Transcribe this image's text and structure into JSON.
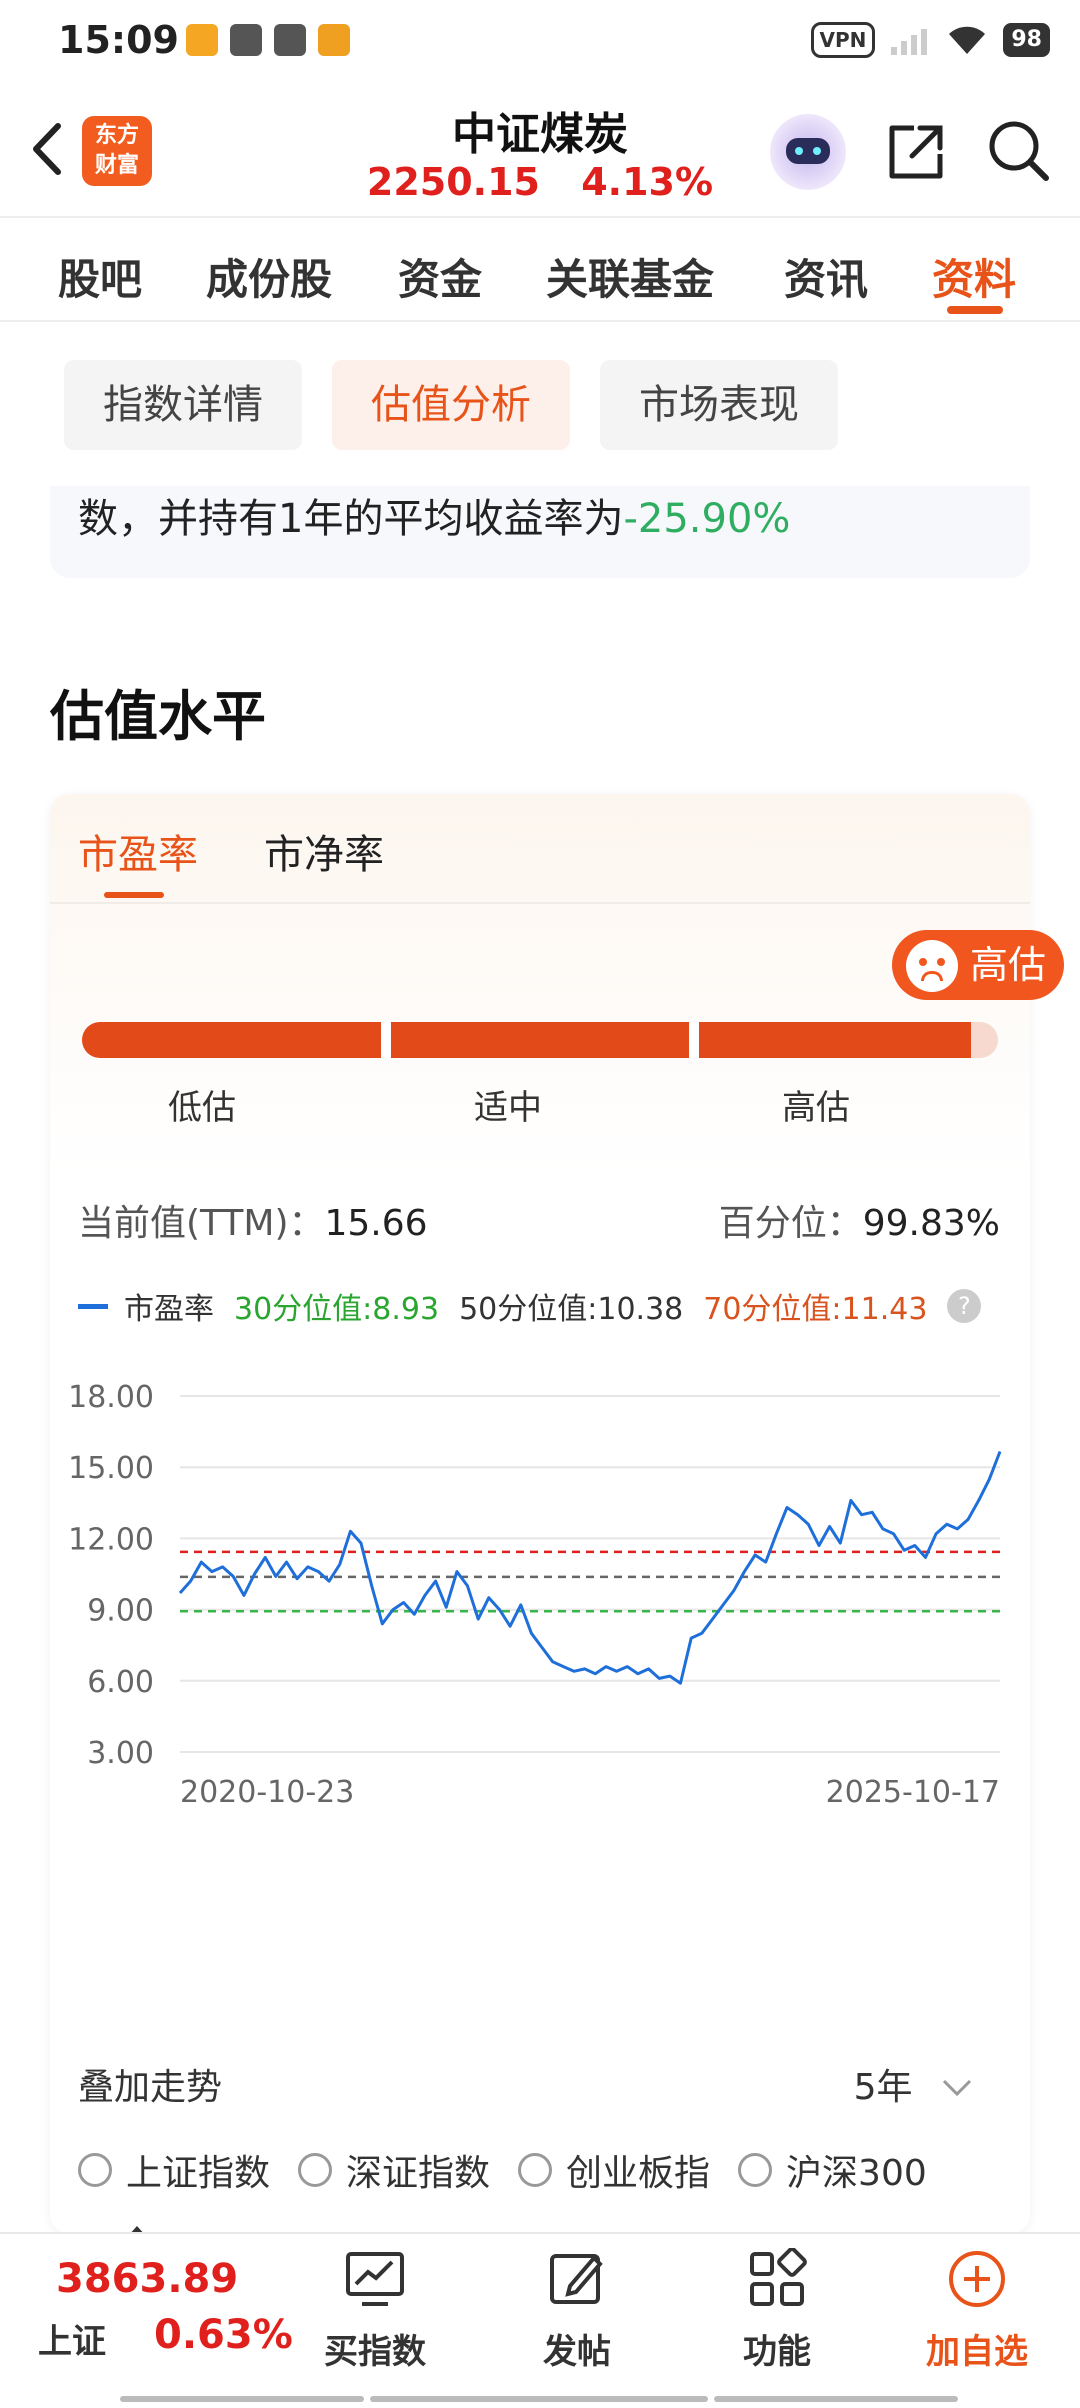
{
  "status_bar": {
    "time": "15:09",
    "vpn": "VPN",
    "battery": "98"
  },
  "header": {
    "logo_line1": "东方",
    "logo_line2": "财富",
    "title": "中证煤炭",
    "price": "2250.15",
    "change_pct": "4.13%"
  },
  "main_tabs": [
    "股吧",
    "成份股",
    "资金",
    "关联基金",
    "资讯",
    "资料"
  ],
  "main_tab_active": "资料",
  "sub_tabs": [
    "指数详情",
    "估值分析",
    "市场表现"
  ],
  "summary": {
    "text": "数，并持有1年的平均收益率为",
    "value": "-25.90%"
  },
  "section_title": "估值水平",
  "valuation": {
    "tabs": [
      "市盈率",
      "市净率"
    ],
    "badge": "高估",
    "gauge_labels": [
      "低估",
      "适中",
      "高估"
    ],
    "gauge_level": 0.97,
    "current_label": "当前值(TTM)：",
    "current_value": "15.66",
    "percentile_label": "百分位：",
    "percentile_value": "99.83%",
    "legend": {
      "series": "市盈率",
      "p30": "30分位值:8.93",
      "p50": "50分位值:10.38",
      "p70": "70分位值:11.43",
      "help": "?"
    },
    "overlay_label": "叠加走势",
    "range": "5年",
    "overlay_options": [
      "上证指数",
      "深证指数",
      "创业板指",
      "沪深300"
    ]
  },
  "chart_data": {
    "type": "line",
    "title": "",
    "xlabel": "",
    "ylabel": "",
    "y_ticks": [
      "18.00",
      "15.00",
      "12.00",
      "9.00",
      "6.00",
      "3.00"
    ],
    "ylim": [
      3,
      18
    ],
    "x_tick_labels": [
      "2020-10-23",
      "2025-10-17"
    ],
    "reference_lines": [
      {
        "value": 8.93,
        "color": "#3ab54a"
      },
      {
        "value": 10.38,
        "color": "#666666"
      },
      {
        "value": 11.43,
        "color": "#e0201c"
      }
    ],
    "series": [
      {
        "name": "市盈率",
        "color": "#1e6fd9",
        "values": [
          9.7,
          10.2,
          11.0,
          10.6,
          10.8,
          10.4,
          9.6,
          10.5,
          11.2,
          10.4,
          11.0,
          10.3,
          10.8,
          10.6,
          10.2,
          10.9,
          12.3,
          11.8,
          10.0,
          8.4,
          9.0,
          9.3,
          8.8,
          9.6,
          10.2,
          9.1,
          10.6,
          10.0,
          8.6,
          9.5,
          9.0,
          8.3,
          9.2,
          8.0,
          7.4,
          6.8,
          6.6,
          6.4,
          6.5,
          6.3,
          6.6,
          6.4,
          6.6,
          6.3,
          6.5,
          6.1,
          6.2,
          5.9,
          7.8,
          8.0,
          8.6,
          9.2,
          9.8,
          10.6,
          11.3,
          11.0,
          12.2,
          13.3,
          13.0,
          12.6,
          11.7,
          12.5,
          11.8,
          13.6,
          13.0,
          13.1,
          12.4,
          12.2,
          11.5,
          11.7,
          11.2,
          12.2,
          12.6,
          12.4,
          12.8,
          13.6,
          14.5,
          15.66
        ]
      }
    ]
  },
  "bottom_bar": {
    "index_value": "3863.89",
    "index_name": "上证",
    "index_pct": "0.63%",
    "items": [
      "买指数",
      "发帖",
      "功能",
      "加自选"
    ]
  }
}
